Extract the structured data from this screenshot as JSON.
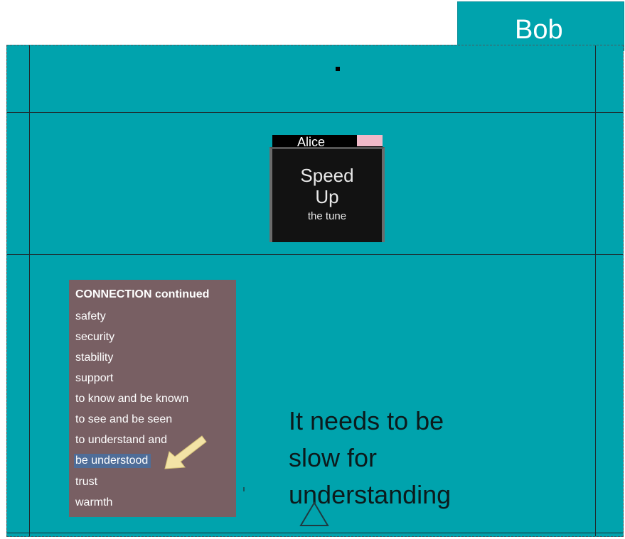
{
  "header": {
    "user_tab": "Bob"
  },
  "card_alice": {
    "owner": "Alice",
    "line1": "Speed",
    "line2": "Up",
    "line3": "the tune"
  },
  "connection_card": {
    "title": "CONNECTION continued",
    "items": [
      "safety",
      "security",
      "stability",
      "support",
      "to know and be known",
      "to see and be seen",
      "to understand and",
      "be understood",
      "trust",
      "warmth"
    ],
    "highlighted_index": 7
  },
  "note": {
    "line1": "It needs to be",
    "line2": "slow for",
    "line3": "understanding"
  },
  "colors": {
    "board": "#00a3ad",
    "connection_card": "#785f63",
    "highlight": "#4f6d98",
    "alice_tag": "#f0b9c8",
    "arrow": "#f3e3a6"
  }
}
